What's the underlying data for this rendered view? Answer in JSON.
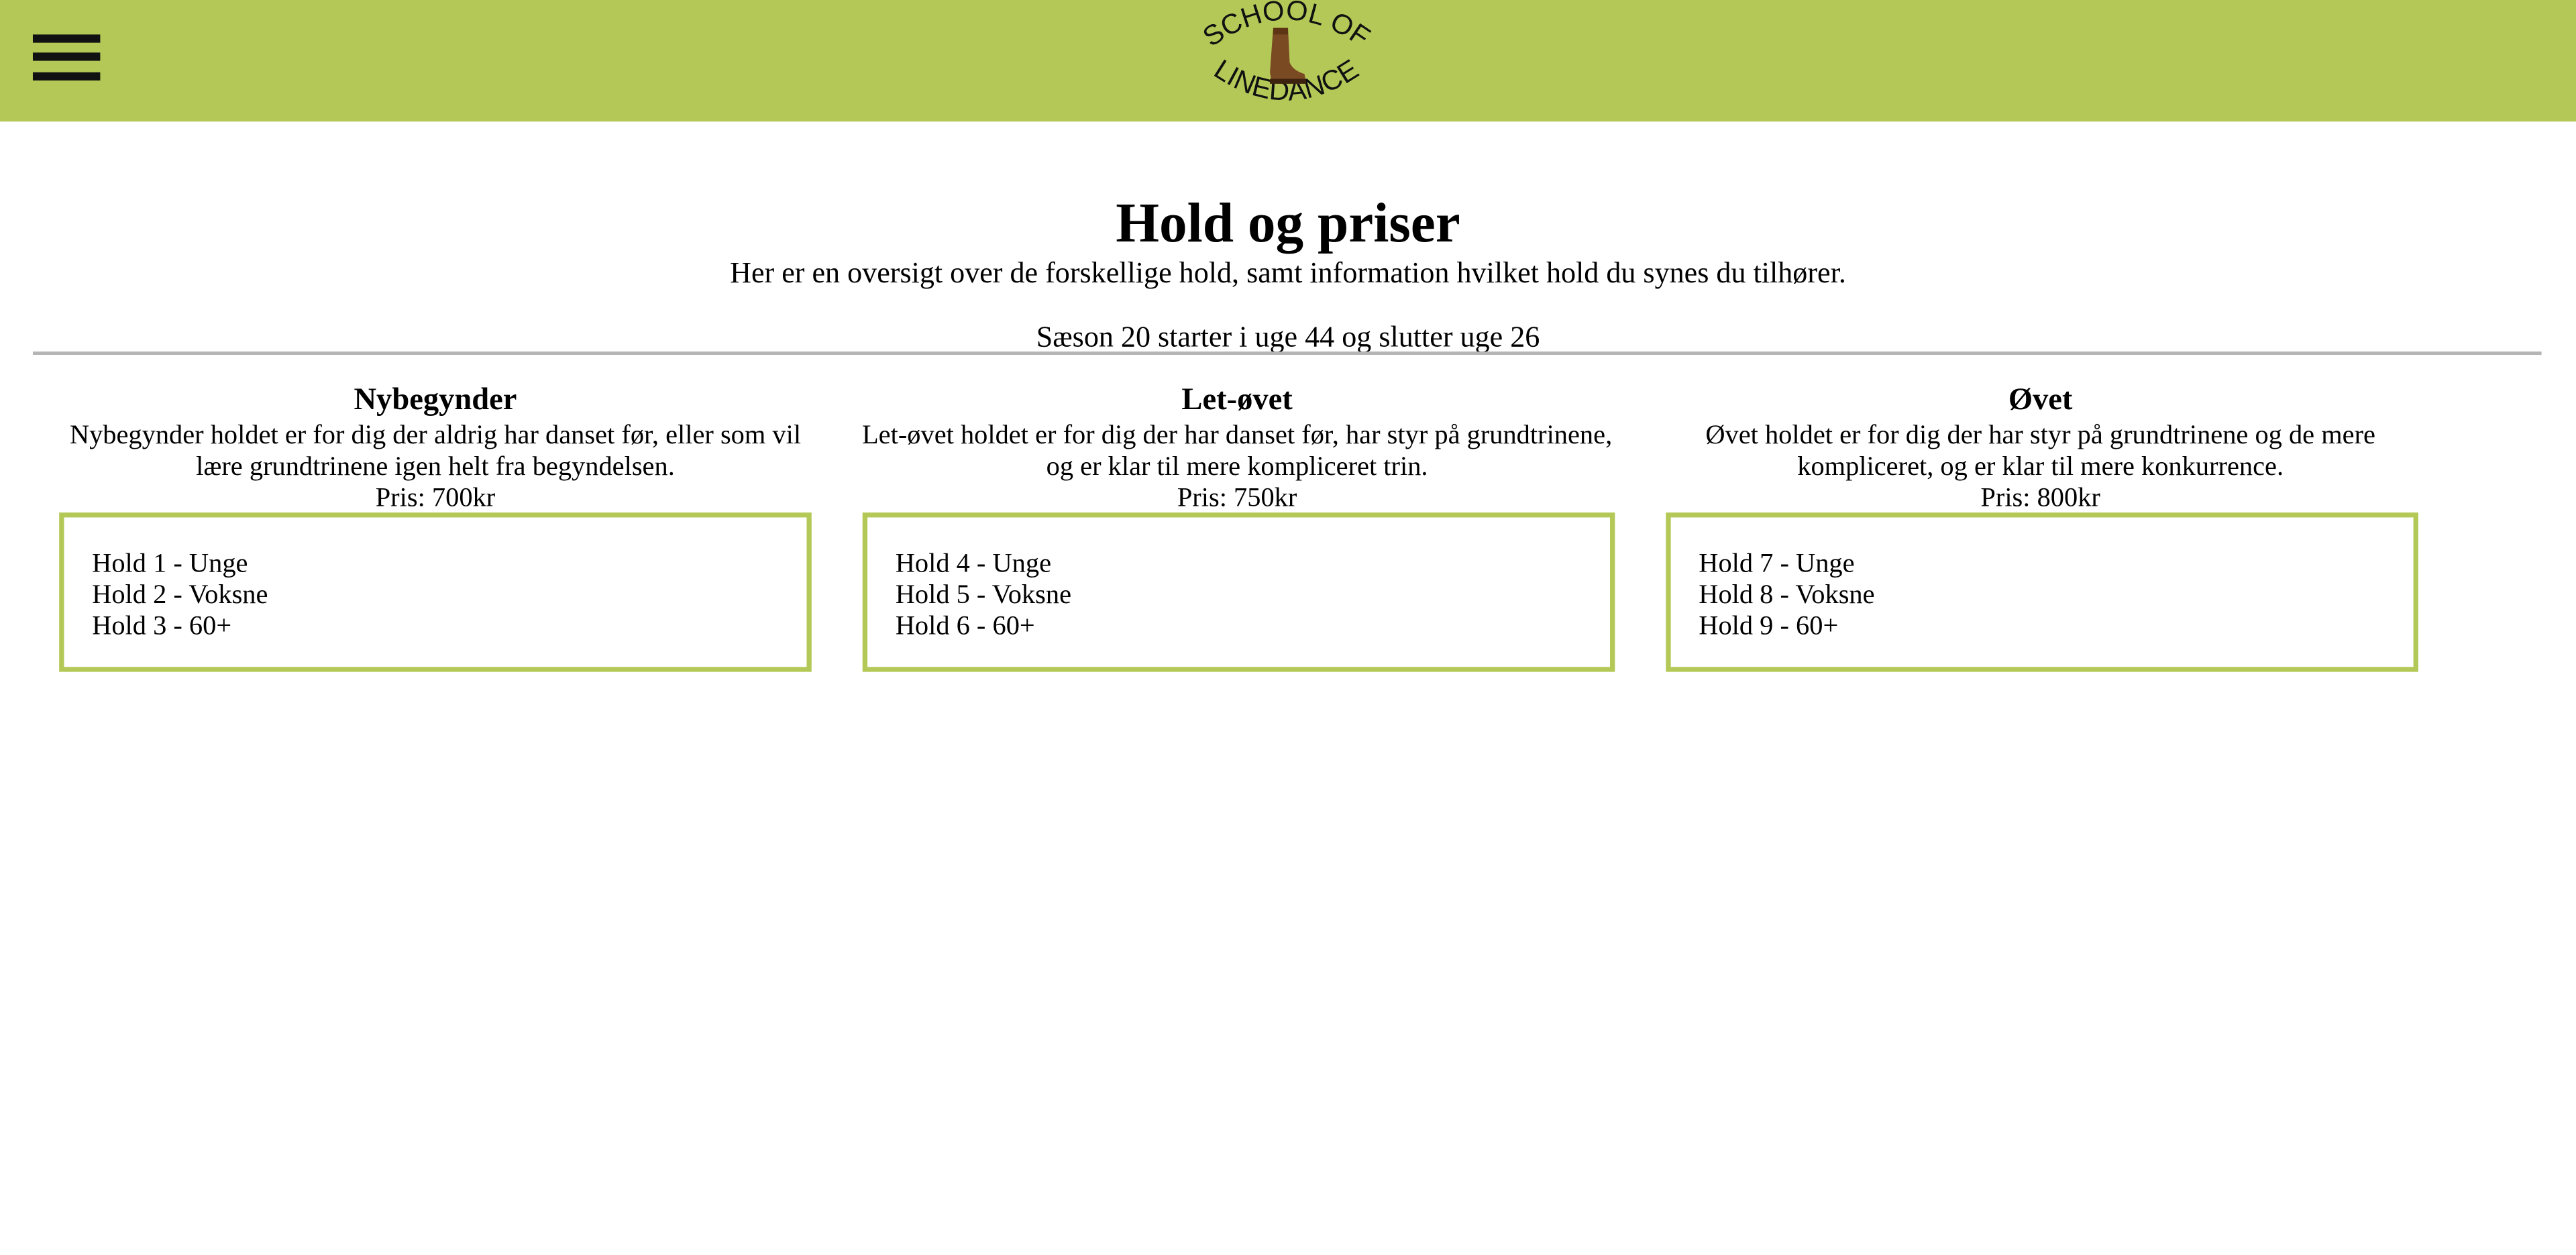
{
  "header": {
    "menu_icon": "hamburger-menu-icon",
    "logo": {
      "text_top": "SCHOOL OF",
      "text_bottom": "LINEDANCE",
      "icon": "cowboy-boot-icon"
    },
    "background_color": "#b4c857"
  },
  "main": {
    "title": "Hold og priser",
    "intro": "Her er en oversigt over de forskellige hold, samt information hvilket hold du synes du tilhører.",
    "season": "Sæson 20 starter i uge 44 og slutter uge 26",
    "accent_color": "#b4c857",
    "levels": [
      {
        "title": "Nybegynder",
        "description": "Nybegynder holdet er for dig der aldrig har danset før, eller som vil lære grundtrinene igen helt fra begyndelsen.",
        "price": "Pris: 700kr",
        "teams": [
          "Hold 1 - Unge",
          "Hold 2 - Voksne",
          "Hold 3 - 60+"
        ]
      },
      {
        "title": "Let-øvet",
        "description": "Let-øvet holdet er for dig der har danset før, har styr på grundtrinene, og er klar til mere kompliceret trin.",
        "price": "Pris: 750kr",
        "teams": [
          "Hold 4 - Unge",
          "Hold 5 - Voksne",
          "Hold 6 - 60+"
        ]
      },
      {
        "title": "Øvet",
        "description": "Øvet holdet er for dig der har styr på grundtrinene og de mere kompliceret, og er klar til mere konkurrence.",
        "price": "Pris: 800kr",
        "teams": [
          "Hold 7 - Unge",
          "Hold 8 - Voksne",
          "Hold 9 - 60+"
        ]
      }
    ]
  }
}
